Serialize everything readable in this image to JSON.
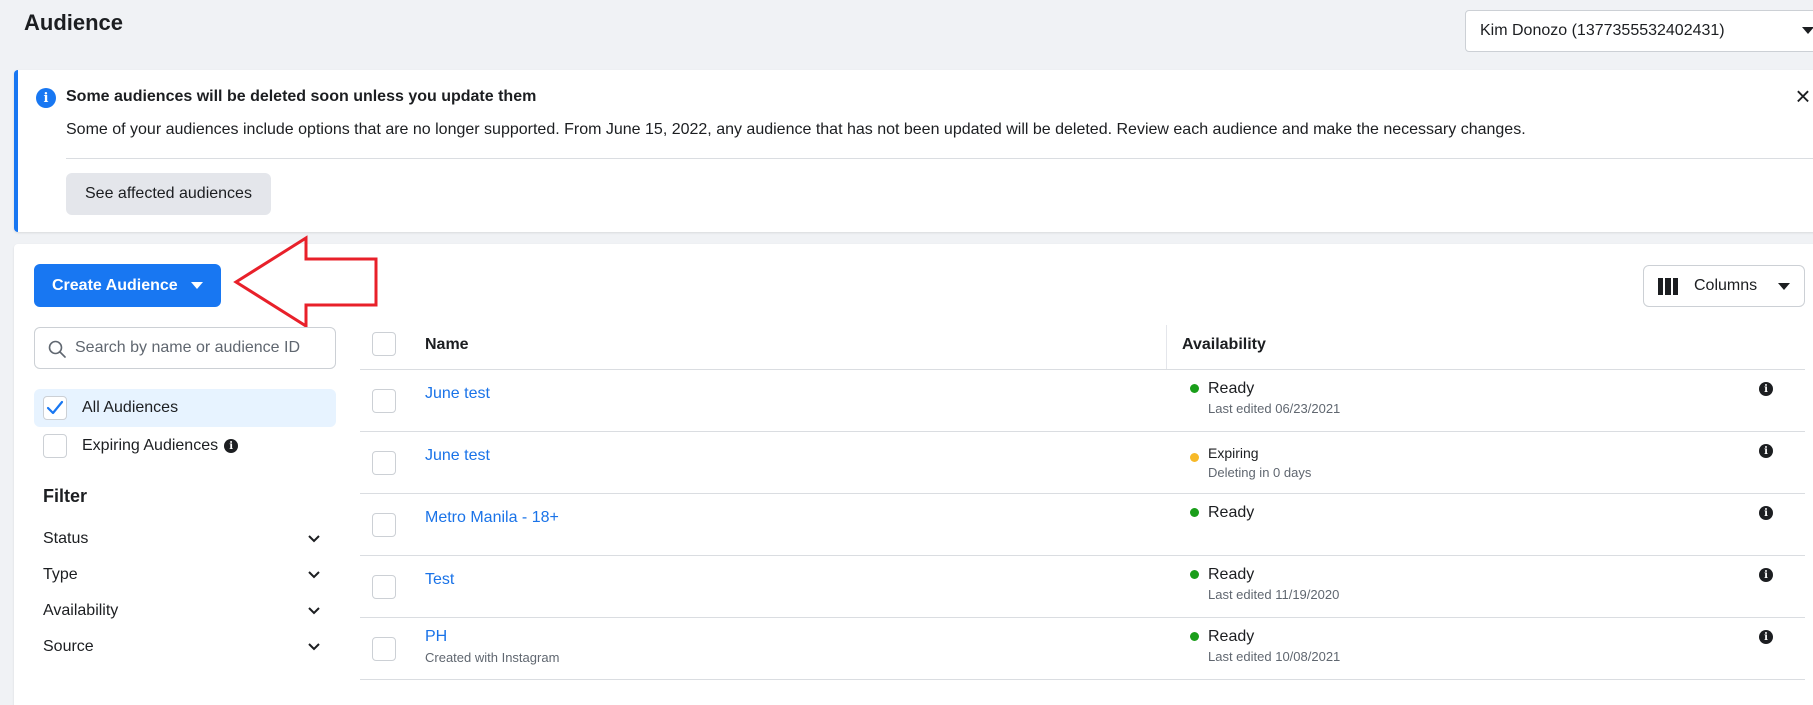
{
  "header": {
    "title": "Audience",
    "account_selector": "Kim Donozo (1377355532402431)"
  },
  "banner": {
    "title": "Some audiences will be deleted soon unless you update them",
    "body": "Some of your audiences include options that are no longer supported. From June 15, 2022, any audience that has not been updated will be deleted. Review each audience and make the necessary changes.",
    "button_label": "See affected audiences",
    "close_symbol": "×",
    "info_symbol": "i"
  },
  "toolbar": {
    "create_label": "Create Audience",
    "columns_label": "Columns"
  },
  "sidebar": {
    "search_placeholder": "Search by name or audience ID",
    "audience_options": [
      {
        "label": "All Audiences",
        "checked": true
      },
      {
        "label": "Expiring Audiences",
        "checked": false
      }
    ],
    "filter_title": "Filter",
    "filters": [
      "Status",
      "Type",
      "Availability",
      "Source"
    ]
  },
  "table": {
    "headers": {
      "name": "Name",
      "availability": "Availability"
    },
    "rows": [
      {
        "name": "June test",
        "subtitle": "",
        "status": "Ready",
        "status_detail": "Last edited 06/23/2021",
        "status_color": "#1a9e1a"
      },
      {
        "name": "June test",
        "subtitle": "",
        "status": "Expiring",
        "status_detail": "Deleting in 0 days",
        "status_color": "#f7b928"
      },
      {
        "name": "Metro Manila - 18+",
        "subtitle": "",
        "status": "Ready",
        "status_detail": "",
        "status_color": "#1a9e1a"
      },
      {
        "name": "Test",
        "subtitle": "",
        "status": "Ready",
        "status_detail": "Last edited 11/19/2020",
        "status_color": "#1a9e1a"
      },
      {
        "name": "PH",
        "subtitle": "Created with Instagram",
        "status": "Ready",
        "status_detail": "Last edited 10/08/2021",
        "status_color": "#1a9e1a"
      }
    ]
  },
  "colors": {
    "accent": "#1877f2",
    "link": "#1a73e8",
    "annotation_arrow": "#e8202a"
  }
}
